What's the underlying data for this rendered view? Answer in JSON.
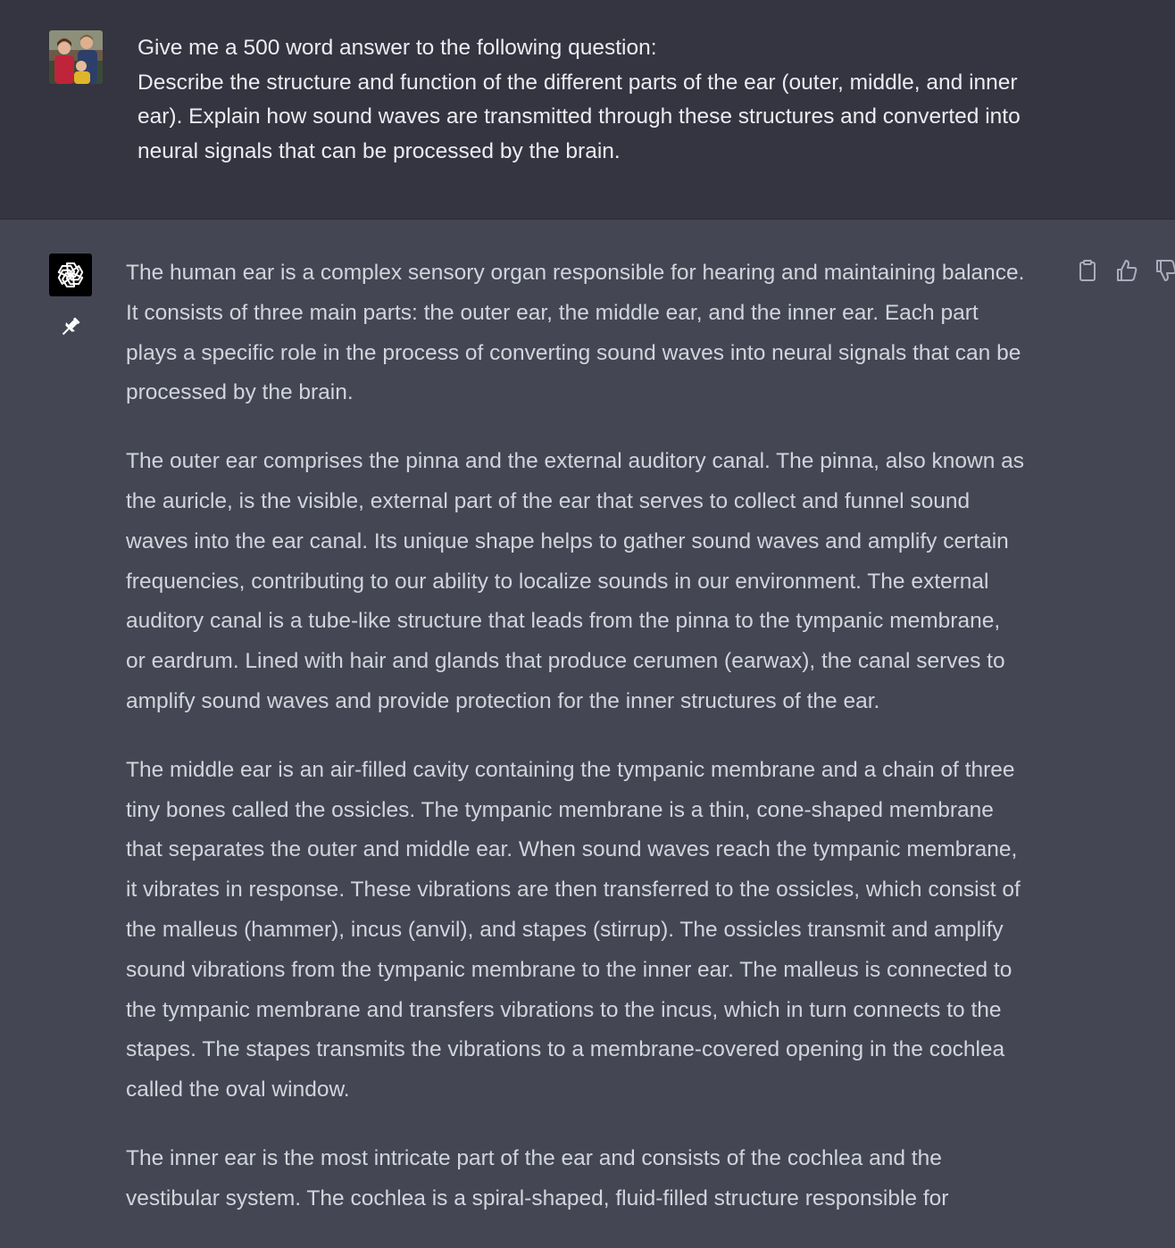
{
  "user_message": {
    "lines": [
      "Give me a 500 word answer to the following question:",
      "Describe the structure and function of the different parts of the ear (outer, middle, and inner",
      "ear). Explain how sound waves are transmitted through these structures and converted into",
      "neural signals that can be processed by the brain."
    ]
  },
  "assistant_message": {
    "paragraphs": [
      [
        "The human ear is a complex sensory organ responsible for hearing and maintaining balance.",
        "It consists of three main parts: the outer ear, the middle ear, and the inner ear. Each part",
        "plays a specific role in the process of converting sound waves into neural signals that can be",
        "processed by the brain."
      ],
      [
        "The outer ear comprises the pinna and the external auditory canal. The pinna, also known as",
        "the auricle, is the visible, external part of the ear that serves to collect and funnel sound",
        "waves into the ear canal. Its unique shape helps to gather sound waves and amplify certain",
        "frequencies, contributing to our ability to localize sounds in our environment. The external",
        "auditory canal is a tube-like structure that leads from the pinna to the tympanic membrane,",
        "or eardrum. Lined with hair and glands that produce cerumen (earwax), the canal serves to",
        "amplify sound waves and provide protection for the inner structures of the ear."
      ],
      [
        "The middle ear is an air-filled cavity containing the tympanic membrane and a chain of three",
        "tiny bones called the ossicles. The tympanic membrane is a thin, cone-shaped membrane",
        "that separates the outer and middle ear. When sound waves reach the tympanic membrane,",
        "it vibrates in response. These vibrations are then transferred to the ossicles, which consist of",
        "the malleus (hammer), incus (anvil), and stapes (stirrup). The ossicles transmit and amplify",
        "sound vibrations from the tympanic membrane to the inner ear. The malleus is connected to",
        "the tympanic membrane and transfers vibrations to the incus, which in turn connects to the",
        "stapes. The stapes transmits the vibrations to a membrane-covered opening in the cochlea",
        "called the oval window."
      ],
      [
        "The inner ear is the most intricate part of the ear and consists of the cochlea and the",
        "vestibular system. The cochlea is a spiral-shaped, fluid-filled structure responsible for"
      ]
    ]
  },
  "icons": {
    "user_avatar": "family-photo-avatar",
    "assistant_avatar": "openai-logo-icon",
    "pin": "pin-icon",
    "copy": "clipboard-icon",
    "thumbs_up": "thumbs-up-icon",
    "thumbs_down": "thumbs-down-icon"
  },
  "colors": {
    "user_bg": "#343541",
    "assistant_bg": "#444654",
    "user_text": "#ececf1",
    "assistant_text": "#d1d5db",
    "icon": "#acacbe"
  }
}
